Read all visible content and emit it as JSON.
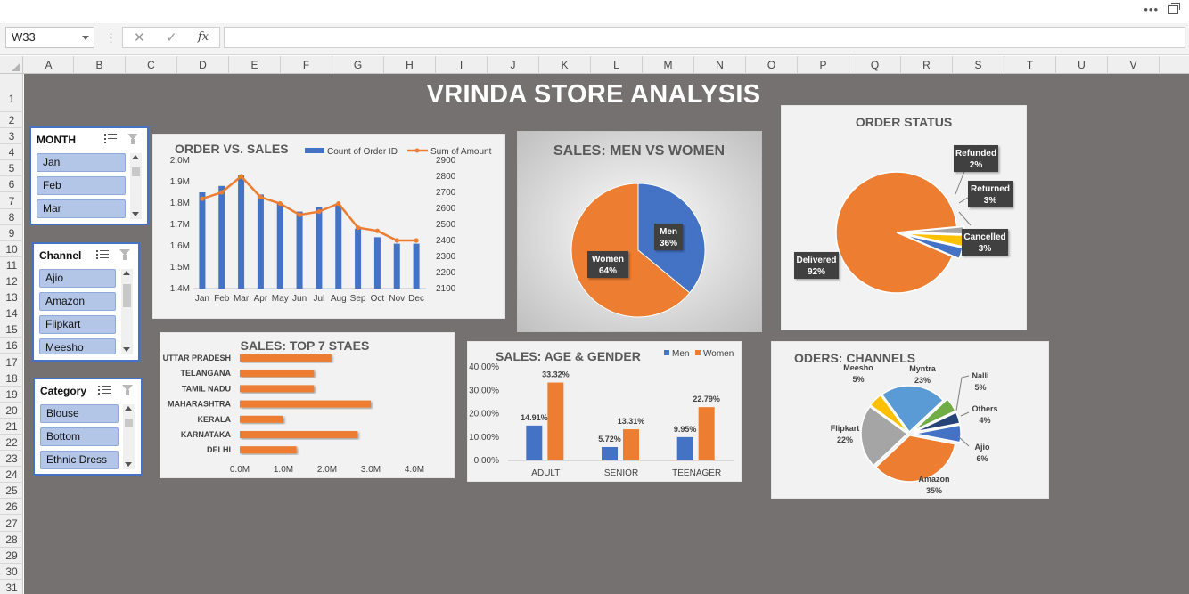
{
  "window": {
    "more_icon": "ellipsis-icon",
    "restore_icon": "restore-window-icon"
  },
  "formula_bar": {
    "name_box": "W33",
    "cancel_glyph": "✕",
    "enter_glyph": "✓",
    "fx_glyph": "fx",
    "value": ""
  },
  "columns": [
    "A",
    "B",
    "C",
    "D",
    "E",
    "F",
    "G",
    "H",
    "I",
    "J",
    "K",
    "L",
    "M",
    "N",
    "O",
    "P",
    "Q",
    "R",
    "S",
    "T",
    "U",
    "V"
  ],
  "rows": [
    "1",
    "2",
    "3",
    "4",
    "5",
    "6",
    "7",
    "8",
    "9",
    "10",
    "11",
    "12",
    "13",
    "14",
    "15",
    "16",
    "17",
    "18",
    "19",
    "20",
    "21",
    "22",
    "23",
    "24",
    "25",
    "26",
    "27",
    "28",
    "29",
    "30",
    "31"
  ],
  "dashboard": {
    "title": "VRINDA STORE ANALYSIS"
  },
  "slicers": {
    "month": {
      "title": "MONTH",
      "items": [
        "Jan",
        "Feb",
        "Mar"
      ]
    },
    "channel": {
      "title": "Channel",
      "items": [
        "Ajio",
        "Amazon",
        "Flipkart",
        "Meesho"
      ]
    },
    "category": {
      "title": "Category",
      "items": [
        "Blouse",
        "Bottom",
        "Ethnic Dress"
      ]
    }
  },
  "colors": {
    "blue": "#4472c4",
    "orange": "#ed7d31",
    "gray": "#a5a5a5",
    "yellow": "#ffc000",
    "light_blue": "#5b9bd5",
    "green": "#70ad47",
    "navy": "#264478",
    "canvas": "#767171"
  },
  "chart_data": [
    {
      "id": "order_vs_sales",
      "type": "bar",
      "title": "ORDER VS. SALES",
      "categories": [
        "Jan",
        "Feb",
        "Mar",
        "Apr",
        "May",
        "Jun",
        "Jul",
        "Aug",
        "Sep",
        "Oct",
        "Nov",
        "Dec"
      ],
      "series": [
        {
          "name": "Count of Order ID",
          "type": "bar",
          "axis": "left",
          "values": [
            1.85,
            1.88,
            1.93,
            1.84,
            1.8,
            1.76,
            1.78,
            1.79,
            1.68,
            1.64,
            1.61,
            1.61
          ]
        },
        {
          "name": "Sum of Amount",
          "type": "line",
          "axis": "right",
          "values": [
            2660,
            2700,
            2800,
            2670,
            2630,
            2560,
            2580,
            2630,
            2480,
            2460,
            2400,
            2400
          ]
        }
      ],
      "left_ticks": [
        "1.4M",
        "1.5M",
        "1.6M",
        "1.7M",
        "1.8M",
        "1.9M",
        "2.0M"
      ],
      "left_range": [
        1.4,
        2.0
      ],
      "right_ticks": [
        "2100",
        "2200",
        "2300",
        "2400",
        "2500",
        "2600",
        "2700",
        "2800",
        "2900"
      ],
      "right_range": [
        2100,
        2900
      ],
      "legend_position": "top-right"
    },
    {
      "id": "men_vs_women",
      "type": "pie",
      "title": "SALES: MEN VS WOMEN",
      "slices": [
        {
          "label": "Men",
          "value": 36,
          "pct": "36%"
        },
        {
          "label": "Women",
          "value": 64,
          "pct": "64%"
        }
      ]
    },
    {
      "id": "order_status",
      "type": "pie",
      "title": "ORDER STATUS",
      "slices": [
        {
          "label": "Delivered",
          "value": 92,
          "pct": "92%"
        },
        {
          "label": "Refunded",
          "value": 2,
          "pct": "2%"
        },
        {
          "label": "Returned",
          "value": 3,
          "pct": "3%"
        },
        {
          "label": "Cancelled",
          "value": 3,
          "pct": "3%"
        }
      ]
    },
    {
      "id": "top_states",
      "type": "bar",
      "orientation": "horizontal",
      "title": "SALES: TOP 7 STAES",
      "categories": [
        "UTTAR PRADESH",
        "TELANGANA",
        "TAMIL NADU",
        "MAHARASHTRA",
        "KERALA",
        "KARNATAKA",
        "DELHI"
      ],
      "values": [
        2.1,
        1.7,
        1.7,
        3.0,
        1.0,
        2.7,
        1.3
      ],
      "ticks": [
        "0.0M",
        "1.0M",
        "2.0M",
        "3.0M",
        "4.0M"
      ],
      "xlim": [
        0,
        4.0
      ]
    },
    {
      "id": "age_gender",
      "type": "bar",
      "title": "SALES: AGE & GENDER",
      "categories": [
        "ADULT",
        "SENIOR",
        "TEENAGER"
      ],
      "series": [
        {
          "name": "Men",
          "values": [
            14.91,
            5.72,
            9.95
          ],
          "labels": [
            "14.91%",
            "5.72%",
            "9.95%"
          ]
        },
        {
          "name": "Women",
          "values": [
            33.32,
            13.31,
            22.79
          ],
          "labels": [
            "33.32%",
            "13.31%",
            "22.79%"
          ]
        }
      ],
      "ticks": [
        "0.00%",
        "10.00%",
        "20.00%",
        "30.00%",
        "40.00%"
      ],
      "ylim": [
        0,
        40
      ],
      "legend_position": "top-right"
    },
    {
      "id": "channels",
      "type": "pie",
      "title": "ODERS: CHANNELS",
      "slices": [
        {
          "label": "Amazon",
          "value": 35,
          "pct": "35%"
        },
        {
          "label": "Flipkart",
          "value": 22,
          "pct": "22%"
        },
        {
          "label": "Meesho",
          "value": 5,
          "pct": "5%"
        },
        {
          "label": "Myntra",
          "value": 23,
          "pct": "23%"
        },
        {
          "label": "Nalli",
          "value": 5,
          "pct": "5%"
        },
        {
          "label": "Others",
          "value": 4,
          "pct": "4%"
        },
        {
          "label": "Ajio",
          "value": 6,
          "pct": "6%"
        }
      ]
    }
  ]
}
